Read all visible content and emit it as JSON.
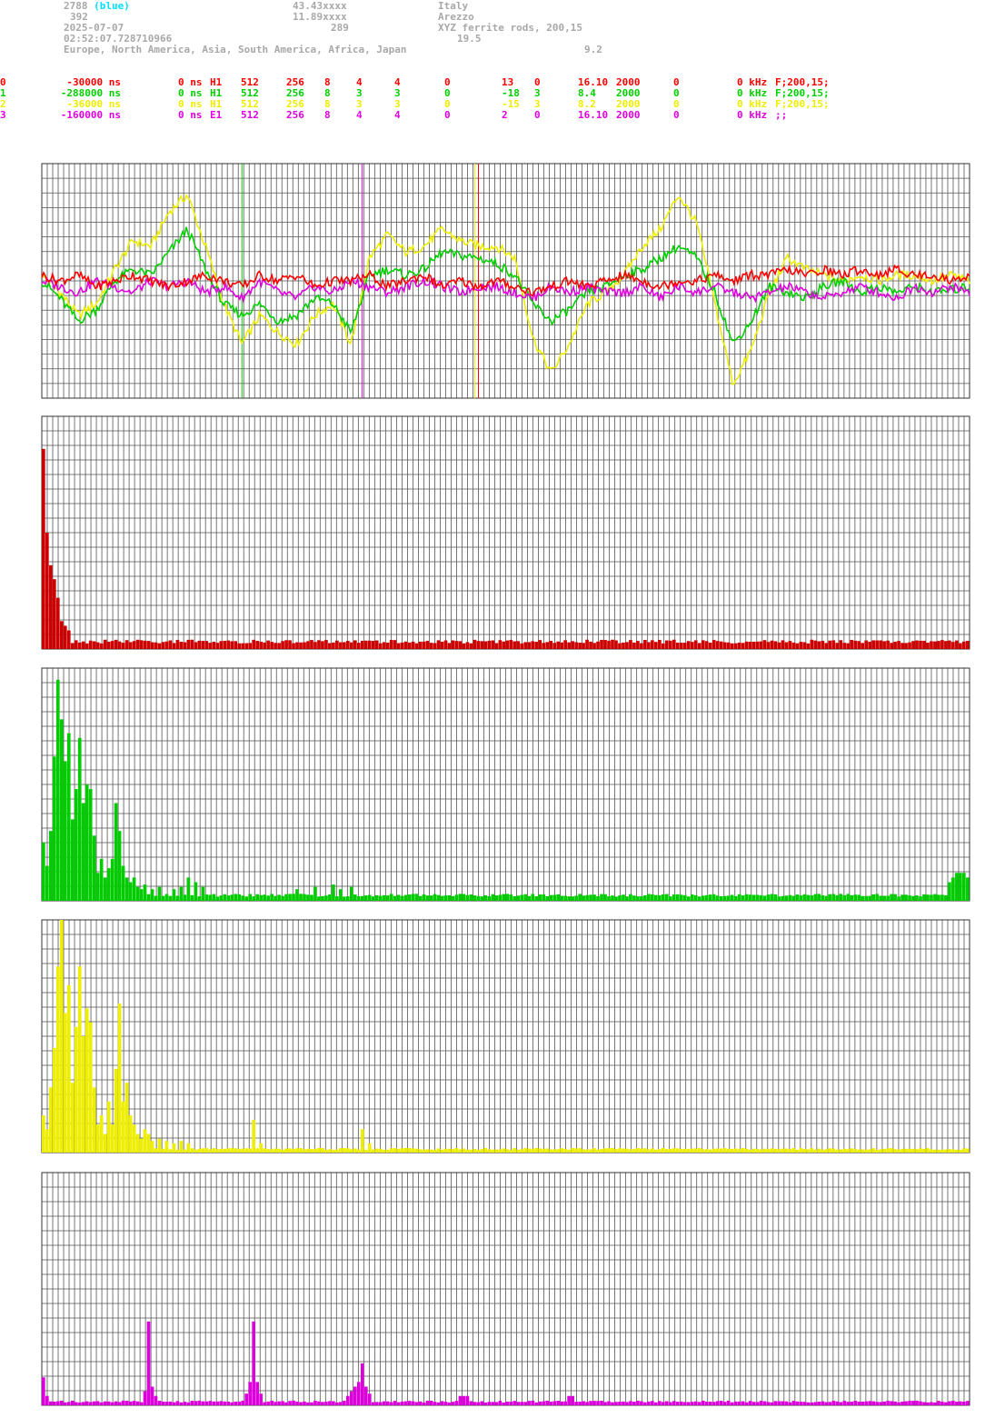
{
  "header": {
    "station_id": "2788",
    "station_color_label": "(blue)",
    "line2_left": "392",
    "date": "2025-07-07",
    "time": "02:52:07.728710966",
    "regions": "Europe, North America, Asia, South America, Africa, Japan",
    "latitude": "43.43xxxx",
    "longitude": "11.89xxxx",
    "altitude": "289",
    "country": "Italy",
    "city": "Arezzo",
    "antenna": "XYZ ferrite rods, 200,15",
    "value_a": "19.5",
    "value_b": "9.2"
  },
  "channels": [
    {
      "idx": "0",
      "offset": "-30000 ns",
      "delay": "0 ns",
      "type": "H1",
      "n1": "512",
      "n2": "256",
      "n3": "8",
      "n4": "4",
      "n5": "4",
      "n6": "0",
      "n7": "13",
      "n8": "0",
      "f1": "16.10",
      "f2": "2000",
      "f3": "0",
      "f4": "0 kHz",
      "filter": "F;200,15;",
      "color": "#ff0000"
    },
    {
      "idx": "1",
      "offset": "-288000 ns",
      "delay": "0 ns",
      "type": "H1",
      "n1": "512",
      "n2": "256",
      "n3": "8",
      "n4": "3",
      "n5": "3",
      "n6": "0",
      "n7": "-18",
      "n8": "3",
      "f1": "8.4",
      "f2": "2000",
      "f3": "0",
      "f4": "0 kHz",
      "filter": "F;200,15;",
      "color": "#00d000"
    },
    {
      "idx": "2",
      "offset": "-36000 ns",
      "delay": "0 ns",
      "type": "H1",
      "n1": "512",
      "n2": "256",
      "n3": "8",
      "n4": "3",
      "n5": "3",
      "n6": "0",
      "n7": "-15",
      "n8": "3",
      "f1": "8.2",
      "f2": "2000",
      "f3": "0",
      "f4": "0 kHz",
      "filter": "F;200,15;",
      "color": "#eeee00"
    },
    {
      "idx": "3",
      "offset": "-160000 ns",
      "delay": "0 ns",
      "type": "E1",
      "n1": "512",
      "n2": "256",
      "n3": "8",
      "n4": "4",
      "n5": "4",
      "n6": "0",
      "n7": "2",
      "n8": "0",
      "f1": "16.10",
      "f2": "2000",
      "f3": "0",
      "f4": "0 kHz",
      "filter": ";;",
      "color": "#e000e0"
    }
  ],
  "chart_data": [
    {
      "type": "line",
      "x": [
        0,
        10,
        20,
        30,
        40,
        50,
        60,
        70,
        80,
        90,
        100,
        110,
        120,
        130,
        140,
        150,
        160,
        170,
        180,
        190,
        200,
        210,
        220,
        230,
        240,
        250,
        260,
        270,
        280,
        290,
        300,
        310,
        320,
        330,
        340,
        350,
        360,
        370,
        380,
        390,
        400,
        410,
        420,
        430,
        440,
        450,
        460,
        470,
        480,
        490,
        500,
        510
      ],
      "ylim": [
        -1,
        1
      ],
      "series": [
        {
          "color": "#eeee00",
          "values": [
            0.05,
            -0.1,
            -0.3,
            -0.2,
            0.1,
            0.35,
            0.3,
            0.6,
            0.75,
            0.3,
            -0.2,
            -0.55,
            -0.3,
            -0.45,
            -0.55,
            -0.3,
            -0.2,
            -0.55,
            0.2,
            0.4,
            0.25,
            0.3,
            0.45,
            0.35,
            0.3,
            0.3,
            0.2,
            -0.5,
            -0.8,
            -0.55,
            -0.2,
            -0.1,
            0.05,
            0.3,
            0.45,
            0.75,
            0.5,
            -0.2,
            -0.9,
            -0.6,
            -0.1,
            0.2,
            0.1,
            0.05,
            0.0,
            0.05,
            0.0,
            0.05,
            0.05,
            0.0,
            0.05,
            0.0
          ]
        },
        {
          "color": "#00d000",
          "values": [
            0.0,
            -0.15,
            -0.35,
            -0.25,
            0.0,
            0.1,
            0.05,
            0.25,
            0.45,
            0.1,
            -0.2,
            -0.3,
            -0.2,
            -0.35,
            -0.3,
            -0.15,
            -0.2,
            -0.45,
            0.05,
            0.1,
            0.05,
            0.1,
            0.25,
            0.22,
            0.2,
            0.15,
            0.05,
            -0.2,
            -0.35,
            -0.25,
            -0.1,
            -0.05,
            0.05,
            0.1,
            0.2,
            0.3,
            0.2,
            -0.1,
            -0.55,
            -0.35,
            -0.05,
            -0.1,
            -0.15,
            -0.05,
            0.0,
            -0.1,
            -0.05,
            -0.1,
            -0.05,
            -0.1,
            -0.08,
            -0.05
          ]
        },
        {
          "color": "#e000e0",
          "values": [
            0.0,
            -0.05,
            -0.1,
            0.0,
            -0.05,
            -0.1,
            0.0,
            -0.05,
            0.0,
            -0.1,
            -0.05,
            -0.15,
            0.0,
            -0.1,
            -0.15,
            -0.05,
            -0.1,
            0.0,
            -0.05,
            -0.1,
            -0.05,
            0.0,
            -0.05,
            -0.1,
            -0.05,
            -0.05,
            -0.1,
            -0.15,
            -0.05,
            -0.1,
            -0.05,
            -0.1,
            -0.1,
            -0.05,
            -0.15,
            -0.05,
            -0.1,
            -0.05,
            -0.1,
            -0.15,
            -0.1,
            -0.05,
            -0.1,
            -0.15,
            -0.1,
            -0.05,
            -0.1,
            -0.15,
            -0.05,
            -0.1,
            -0.05,
            -0.1
          ]
        },
        {
          "color": "#ff0000",
          "values": [
            0.05,
            0.0,
            0.05,
            -0.05,
            0.0,
            0.05,
            0.0,
            -0.05,
            0.0,
            0.05,
            0.0,
            -0.05,
            0.05,
            0.0,
            0.05,
            -0.05,
            0.0,
            0.0,
            0.05,
            -0.05,
            0.0,
            0.05,
            -0.05,
            0.0,
            -0.05,
            0.0,
            -0.05,
            -0.1,
            -0.05,
            0.0,
            -0.05,
            0.0,
            0.05,
            0.0,
            -0.05,
            0.0,
            0.0,
            0.05,
            0.0,
            0.05,
            0.05,
            0.1,
            0.05,
            0.1,
            0.05,
            0.1,
            0.05,
            0.1,
            0.05,
            0.05,
            0.0,
            0.05
          ]
        }
      ],
      "markers": [
        {
          "x": 110,
          "color": "#00d000"
        },
        {
          "x": 176,
          "color": "#e000e0"
        },
        {
          "x": 238,
          "color": "#eeee00"
        },
        {
          "x": 240,
          "color": "#ff0000"
        }
      ]
    },
    {
      "type": "bar",
      "color": "#cc0000",
      "bins": 256,
      "ylim": [
        0,
        1
      ],
      "peaks": [
        [
          0,
          0.86
        ],
        [
          1,
          0.5
        ],
        [
          2,
          0.36
        ],
        [
          3,
          0.3
        ],
        [
          4,
          0.22
        ],
        [
          5,
          0.12
        ],
        [
          6,
          0.1
        ],
        [
          7,
          0.08
        ]
      ],
      "baseline": 0.04
    },
    {
      "type": "bar",
      "color": "#00cc00",
      "bins": 256,
      "ylim": [
        0,
        1
      ],
      "peaks": [
        [
          0,
          0.25
        ],
        [
          1,
          0.15
        ],
        [
          2,
          0.3
        ],
        [
          3,
          0.62
        ],
        [
          4,
          0.95
        ],
        [
          5,
          0.78
        ],
        [
          6,
          0.6
        ],
        [
          7,
          0.72
        ],
        [
          8,
          0.35
        ],
        [
          9,
          0.48
        ],
        [
          10,
          0.7
        ],
        [
          11,
          0.42
        ],
        [
          12,
          0.5
        ],
        [
          13,
          0.48
        ],
        [
          14,
          0.28
        ],
        [
          15,
          0.12
        ],
        [
          16,
          0.18
        ],
        [
          17,
          0.1
        ],
        [
          18,
          0.14
        ],
        [
          19,
          0.18
        ],
        [
          20,
          0.42
        ],
        [
          21,
          0.3
        ],
        [
          22,
          0.15
        ],
        [
          23,
          0.1
        ],
        [
          24,
          0.08
        ],
        [
          25,
          0.1
        ],
        [
          26,
          0.06
        ],
        [
          27,
          0.05
        ],
        [
          28,
          0.07
        ],
        [
          30,
          0.05
        ],
        [
          32,
          0.06
        ],
        [
          36,
          0.05
        ],
        [
          38,
          0.06
        ],
        [
          40,
          0.1
        ],
        [
          42,
          0.08
        ],
        [
          44,
          0.06
        ],
        [
          70,
          0.05
        ],
        [
          75,
          0.06
        ],
        [
          80,
          0.07
        ],
        [
          82,
          0.05
        ],
        [
          85,
          0.06
        ],
        [
          250,
          0.08
        ],
        [
          251,
          0.1
        ],
        [
          252,
          0.12
        ],
        [
          253,
          0.12
        ],
        [
          254,
          0.12
        ],
        [
          255,
          0.1
        ]
      ],
      "baseline": 0.03
    },
    {
      "type": "bar",
      "color": "#eeee00",
      "bins": 256,
      "ylim": [
        0,
        1
      ],
      "peaks": [
        [
          0,
          0.16
        ],
        [
          1,
          0.1
        ],
        [
          2,
          0.28
        ],
        [
          3,
          0.45
        ],
        [
          4,
          0.8
        ],
        [
          5,
          1.0
        ],
        [
          6,
          0.6
        ],
        [
          7,
          0.72
        ],
        [
          8,
          0.3
        ],
        [
          9,
          0.54
        ],
        [
          10,
          0.8
        ],
        [
          11,
          0.5
        ],
        [
          12,
          0.62
        ],
        [
          13,
          0.56
        ],
        [
          14,
          0.28
        ],
        [
          15,
          0.12
        ],
        [
          16,
          0.16
        ],
        [
          17,
          0.08
        ],
        [
          18,
          0.22
        ],
        [
          19,
          0.12
        ],
        [
          20,
          0.36
        ],
        [
          21,
          0.64
        ],
        [
          22,
          0.22
        ],
        [
          23,
          0.3
        ],
        [
          24,
          0.16
        ],
        [
          25,
          0.12
        ],
        [
          26,
          0.08
        ],
        [
          27,
          0.06
        ],
        [
          28,
          0.1
        ],
        [
          29,
          0.08
        ],
        [
          30,
          0.05
        ],
        [
          32,
          0.06
        ],
        [
          34,
          0.05
        ],
        [
          36,
          0.04
        ],
        [
          38,
          0.05
        ],
        [
          40,
          0.04
        ],
        [
          58,
          0.14
        ],
        [
          60,
          0.04
        ],
        [
          88,
          0.1
        ],
        [
          90,
          0.04
        ]
      ],
      "baseline": 0.02
    },
    {
      "type": "bar",
      "color": "#dd00dd",
      "bins": 256,
      "ylim": [
        0,
        1
      ],
      "peaks": [
        [
          0,
          0.12
        ],
        [
          1,
          0.04
        ],
        [
          28,
          0.06
        ],
        [
          29,
          0.36
        ],
        [
          30,
          0.08
        ],
        [
          31,
          0.04
        ],
        [
          56,
          0.05
        ],
        [
          57,
          0.1
        ],
        [
          58,
          0.36
        ],
        [
          59,
          0.1
        ],
        [
          60,
          0.05
        ],
        [
          84,
          0.04
        ],
        [
          85,
          0.06
        ],
        [
          86,
          0.08
        ],
        [
          87,
          0.1
        ],
        [
          88,
          0.18
        ],
        [
          89,
          0.08
        ],
        [
          90,
          0.05
        ],
        [
          115,
          0.04
        ],
        [
          116,
          0.04
        ],
        [
          117,
          0.04
        ],
        [
          145,
          0.04
        ],
        [
          146,
          0.04
        ]
      ],
      "baseline": 0.02
    }
  ]
}
